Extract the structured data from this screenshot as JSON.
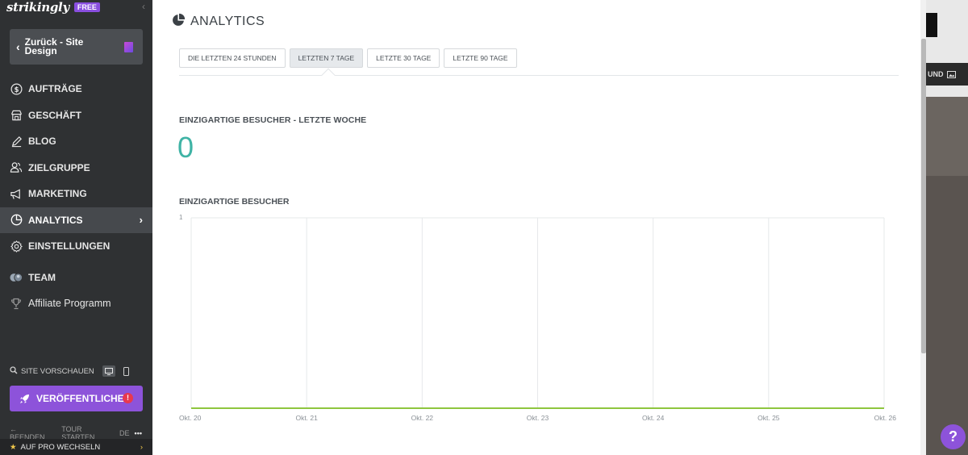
{
  "brand": {
    "logo": "strikingly",
    "plan_badge": "FREE"
  },
  "back_button": {
    "label": "Zurück - Site Design"
  },
  "nav": [
    {
      "label": "AUFTRÄGE",
      "icon": "dollar-circle-icon"
    },
    {
      "label": "GESCHÄFT",
      "icon": "store-icon"
    },
    {
      "label": "BLOG",
      "icon": "pen-icon"
    },
    {
      "label": "ZIELGRUPPE",
      "icon": "users-icon"
    },
    {
      "label": "MARKETING",
      "icon": "megaphone-icon"
    },
    {
      "label": "ANALYTICS",
      "icon": "pie-chart-icon",
      "active": true
    },
    {
      "label": "EINSTELLUNGEN",
      "icon": "gear-icon"
    },
    {
      "label": "TEAM",
      "icon": "team-avatar-icon"
    },
    {
      "label": "Affiliate Programm",
      "icon": "trophy-icon"
    }
  ],
  "preview": {
    "label": "SITE VORSCHAUEN"
  },
  "publish": {
    "label": "VERÖFFENTLICHEN",
    "alert": "!"
  },
  "footer": {
    "exit": "BEENDEN",
    "tour": "TOUR STARTEN",
    "lang": "DE",
    "more": "•••"
  },
  "pro": {
    "label": "AUF PRO WECHSELN"
  },
  "panel": {
    "title": "ANALYTICS",
    "tabs": [
      "DIE LETZTEN 24 STUNDEN",
      "LETZTEN 7 TAGE",
      "LETZTE 30 TAGE",
      "LETZTE 90 TAGE"
    ],
    "active_tab": 1,
    "stat_label": "EINZIGARTIGE BESUCHER - LETZTE WOCHE",
    "stat_value": "0",
    "chart_title": "EINZIGARTIGE BESUCHER"
  },
  "rightstrip": {
    "button_text": "UND"
  },
  "help": {
    "label": "?"
  },
  "colors": {
    "accent": "#8d53da",
    "teal": "#3fb3a5",
    "line": "#8ec63f"
  },
  "chart_data": {
    "type": "line",
    "title": "EINZIGARTIGE BESUCHER",
    "categories": [
      "Okt. 20",
      "Okt. 21",
      "Okt. 22",
      "Okt. 23",
      "Okt. 24",
      "Okt. 25",
      "Okt. 26"
    ],
    "series": [
      {
        "values": [
          0,
          0,
          0,
          0,
          0,
          0,
          0
        ]
      }
    ],
    "yticks": [
      "1"
    ],
    "ylim": [
      0,
      1
    ],
    "grid": true
  }
}
